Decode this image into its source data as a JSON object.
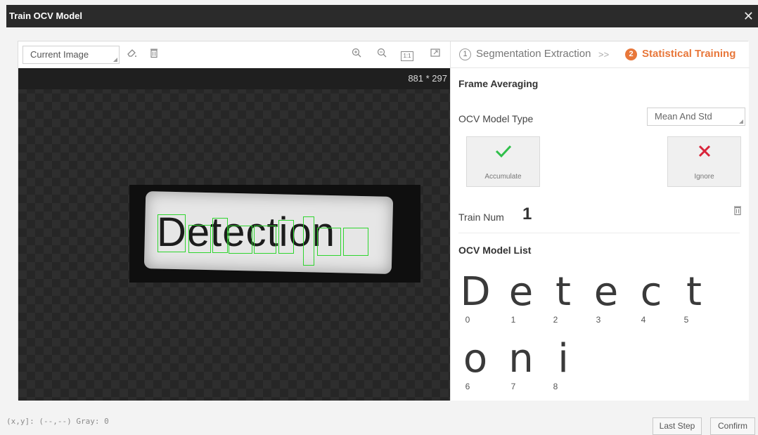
{
  "window": {
    "title": "Train OCV Model",
    "close_glyph": "✕"
  },
  "left_toolbar": {
    "image_select": "Current Image",
    "icons": [
      "eraser-icon",
      "trash-icon",
      "zoom-in-icon",
      "zoom-out-icon",
      "actual-size-icon",
      "fit-window-icon"
    ],
    "actual_size_text": "1:1"
  },
  "canvas": {
    "dimensions": "881 * 297",
    "image_text": "Detection",
    "box_color": "#2ed52e"
  },
  "steps": [
    {
      "num": "1",
      "label": "Segmentation Extraction",
      "separator": ">>",
      "active": false
    },
    {
      "num": "2",
      "label": "Statistical Training",
      "active": true
    }
  ],
  "accent_color": "#e8773a",
  "frame_averaging": {
    "title": "Frame Averaging",
    "model_type_label": "OCV Model Type",
    "model_type_value": "Mean And Std",
    "accumulate_label": "Accumulate",
    "ignore_label": "Ignore",
    "train_num_label": "Train Num",
    "train_num_value": "1"
  },
  "model_list": {
    "title": "OCV Model List",
    "glyphs": [
      {
        "char": "D",
        "index": "0"
      },
      {
        "char": "e",
        "index": "1"
      },
      {
        "char": "t",
        "index": "2"
      },
      {
        "char": "e",
        "index": "3"
      },
      {
        "char": "c",
        "index": "4"
      },
      {
        "char": "t",
        "index": "5"
      },
      {
        "char": "o",
        "index": "6"
      },
      {
        "char": "n",
        "index": "7"
      },
      {
        "char": "i",
        "index": "8"
      }
    ]
  },
  "status": {
    "text": "(x,y]: (--,--) Gray: 0"
  },
  "footer": {
    "last_step": "Last Step",
    "confirm": "Confirm"
  }
}
